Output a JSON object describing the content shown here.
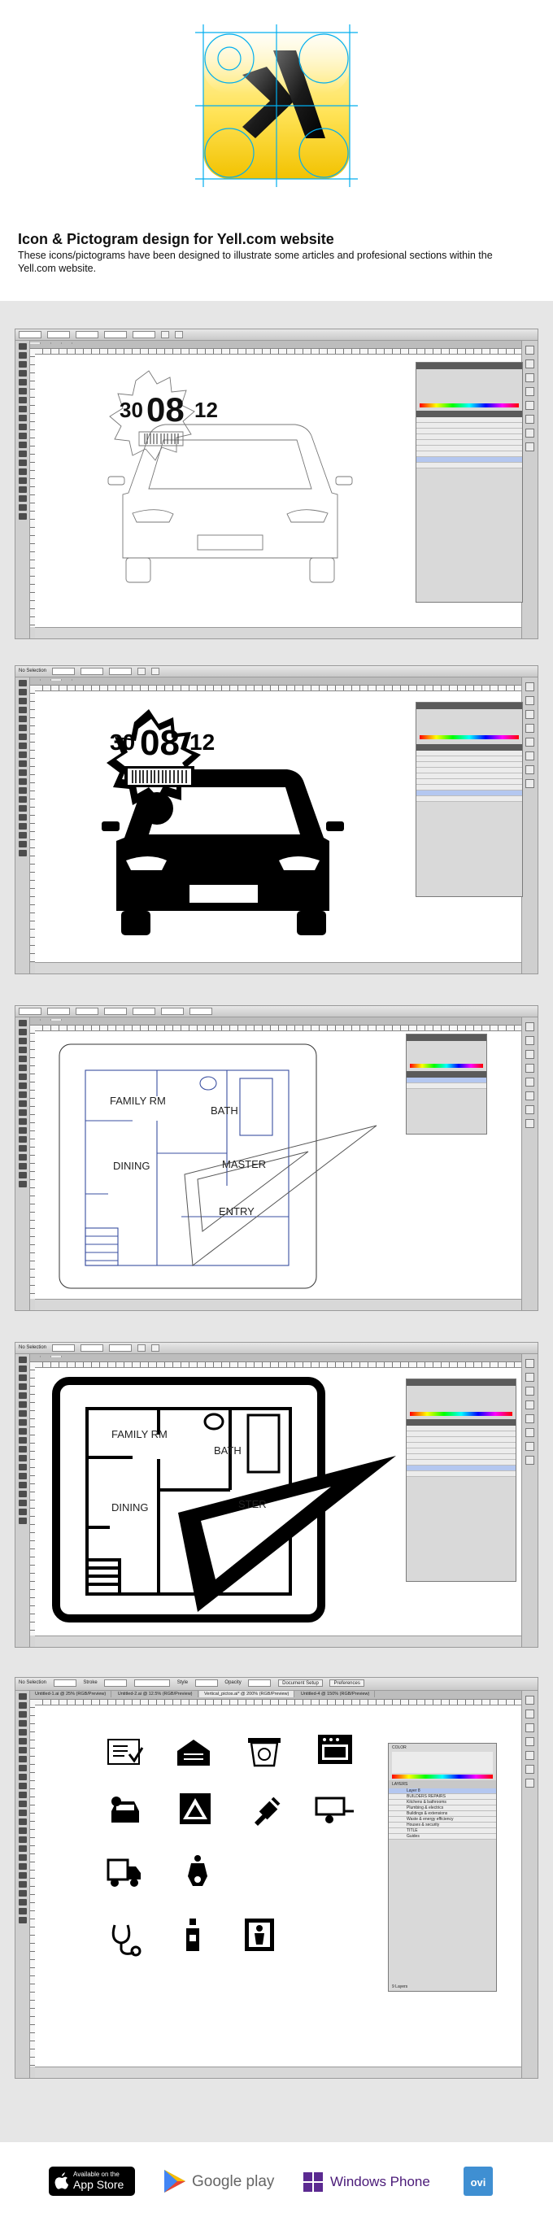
{
  "intro": {
    "title": "Icon & Pictogram design for Yell.com website",
    "text": "These icons/pictograms have been designed to illustrate some articles and profesional sections within the Yell.com website."
  },
  "shot1": {
    "date_day": "30",
    "date_month": "08",
    "date_year": "12"
  },
  "shot2": {
    "selection": "No Selection",
    "date_day": "30",
    "date_month": "08",
    "date_year": "12"
  },
  "shot3": {
    "rooms": {
      "family": "FAMILY RM",
      "bath": "BATH",
      "dining": "DINING",
      "master": "MASTER",
      "entry": "ENTRY"
    }
  },
  "shot4": {
    "selection": "No Selection",
    "rooms": {
      "family": "FAMILY RM",
      "bath": "BATH",
      "dining": "DINING",
      "master": "STER"
    }
  },
  "shot5": {
    "control_bar": {
      "selection": "No Selection",
      "stroke": "Stroke",
      "style": "Style",
      "opacity": "Opacity",
      "document_setup": "Document Setup",
      "preferences": "Preferences"
    },
    "tabs": [
      "Untitled-1.ai @ 25% (RGB/Preview)",
      "Untitled-2.ai @ 12.5% (RGB/Preview)",
      "Vertical_pictos.ai* @ 200% (RGB/Preview)",
      "Untitled-4 @ 150% (RGB/Preview)"
    ],
    "color_panel": "COLOR",
    "layers_panel": "LAYERS",
    "layers": [
      "Layer 8",
      "BUILDERS REPAIRS",
      "Kitchens & bathrooms",
      "Plumbing & electrics",
      "Buildings & extensions",
      "Waste & energy efficiency",
      "Houses & security",
      "TITLE",
      "Guides"
    ],
    "layers_count": "9 Layers"
  },
  "stores": {
    "appstore_line1": "Available on the",
    "appstore_line2": "App Store",
    "google_play": "Google play",
    "windows_phone": "Windows Phone",
    "ovi": "ovi"
  },
  "colors": {
    "yell_yellow": "#ffd700",
    "guide_cyan": "#00aeef",
    "gallery_bg": "#e6e6e6",
    "ui_chrome": "#d5d5d5"
  }
}
